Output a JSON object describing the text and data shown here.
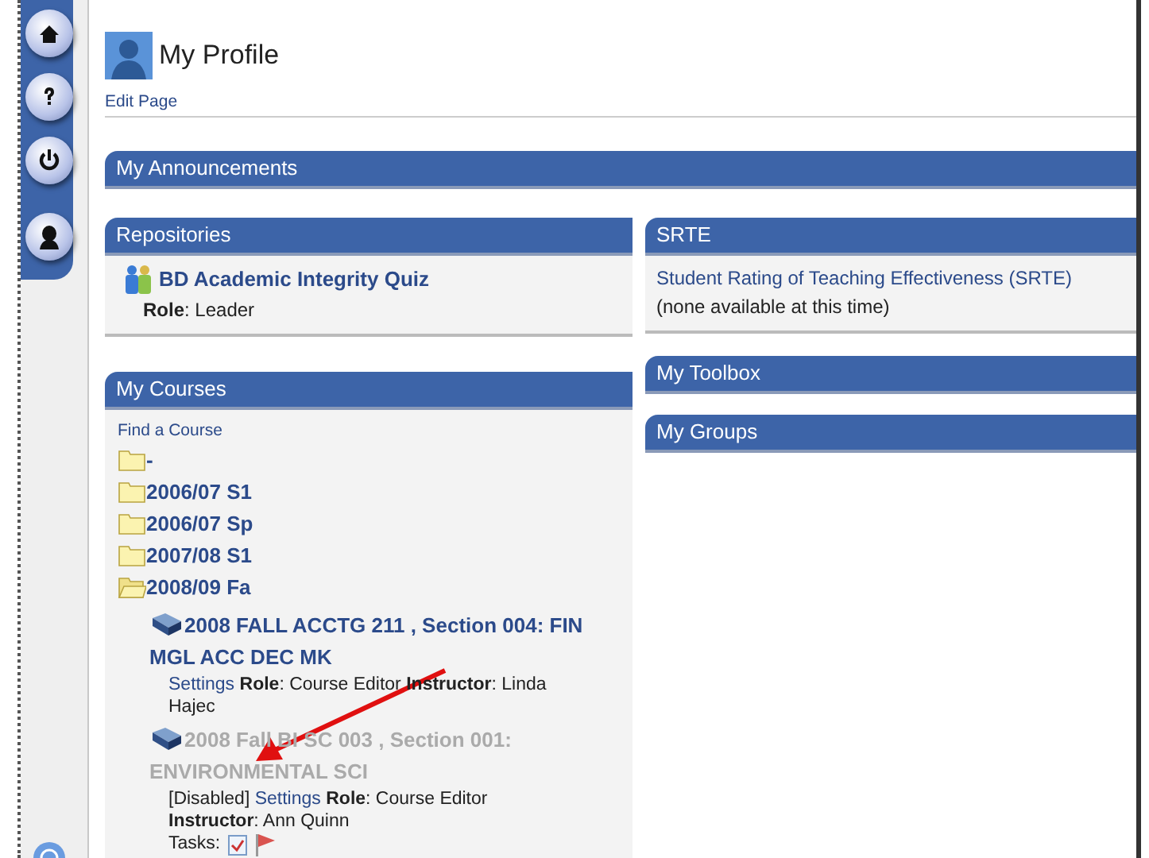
{
  "sidebar": {
    "buttons": [
      {
        "kind": "home"
      },
      {
        "kind": "help"
      },
      {
        "kind": "power"
      },
      {
        "kind": "profile"
      }
    ]
  },
  "header": {
    "title": "My Profile",
    "edit_link": "Edit Page"
  },
  "announcements": {
    "title": "My Announcements"
  },
  "repositories": {
    "title": "Repositories",
    "items": [
      {
        "title": "BD Academic Integrity Quiz",
        "role": "**Role**: Leader"
      }
    ]
  },
  "courses": {
    "title": "My Courses",
    "find_link": "Find a Course",
    "folders": [
      {
        "label": "-",
        "expanded": false
      },
      {
        "label": "2006/07 S1",
        "expanded": false
      },
      {
        "label": "2006/07 Sp",
        "expanded": false
      },
      {
        "label": "2007/08 S1",
        "expanded": false
      },
      {
        "label": "2008/09 Fa",
        "expanded": true,
        "children": [
          {
            "title": "2008 FALL ACCTG 211 , Section 004: FIN MGL ACC DEC MK",
            "disabled": false,
            "settings": "Settings",
            "role": "**Role**: Course Editor **Instructor**: Linda Hajec"
          },
          {
            "title": "2008 Fall BI SC 003 , Section 001: ENVIRONMENTAL SCI",
            "disabled": true,
            "disabled_label": "[Disabled]",
            "settings": "Settings",
            "role": "**Role**: Course Editor **Instructor**: Ann Quinn",
            "tasks_label": "Tasks:"
          }
        ]
      }
    ]
  },
  "srte": {
    "title": "SRTE",
    "link": "Student Rating of Teaching Effectiveness (SRTE)",
    "note": "(none available at this time)"
  },
  "toolbox": {
    "title": "My Toolbox"
  },
  "groups": {
    "title": "My Groups"
  }
}
